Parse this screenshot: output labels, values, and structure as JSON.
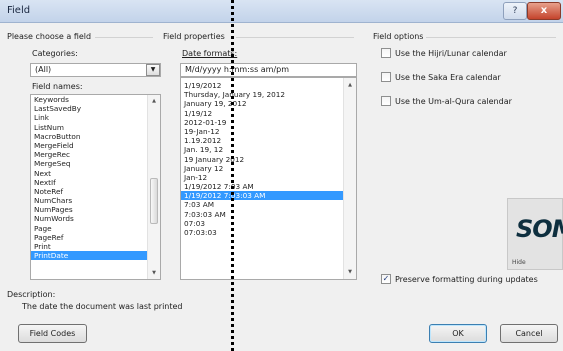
{
  "title": "Field",
  "titlebar": {
    "help_glyph": "?",
    "close_glyph": "x"
  },
  "left": {
    "header": "Please choose a field",
    "categories_label": "Categories:",
    "categories_value": "(All)",
    "field_names_label": "Field names:",
    "field_names": [
      "Keywords",
      "LastSavedBy",
      "Link",
      "ListNum",
      "MacroButton",
      "MergeField",
      "MergeRec",
      "MergeSeq",
      "Next",
      "NextIf",
      "NoteRef",
      "NumChars",
      "NumPages",
      "NumWords",
      "Page",
      "PageRef",
      "Print",
      "PrintDate"
    ],
    "selected_field": "PrintDate"
  },
  "middle": {
    "header": "Field properties",
    "date_formats_label": "Date formats:",
    "date_format_value": "M/d/yyyy h:mm:ss am/pm",
    "formats": [
      "1/19/2012",
      "Thursday, January 19, 2012",
      "January 19, 2012",
      "1/19/12",
      "2012-01-19",
      "19-Jan-12",
      "1.19.2012",
      "Jan. 19, 12",
      "19 January 2012",
      "January 12",
      "Jan-12",
      "1/19/2012 7:03 AM",
      "1/19/2012 7:03:03 AM",
      "7:03 AM",
      "7:03:03 AM",
      "07:03",
      "07:03:03"
    ],
    "selected_format": "1/19/2012 7:03:03 AM"
  },
  "right": {
    "header": "Field options",
    "options": [
      {
        "label": "Use the Hijri/Lunar calendar",
        "checked": false
      },
      {
        "label": "Use the Saka Era calendar",
        "checked": false
      },
      {
        "label": "Use the Um-al-Qura calendar",
        "checked": false
      }
    ],
    "preserve_label": "Preserve formatting during updates",
    "preserve_checked": true
  },
  "description": {
    "label": "Description:",
    "text": "The date the document was last printed"
  },
  "buttons": {
    "field_codes": "Field Codes",
    "ok": "OK",
    "cancel": "Cancel"
  },
  "logo": {
    "text": "SOM",
    "hide_label": "Hide"
  },
  "icons": [
    "dropdown-arrow-icon",
    "scroll-up-arrow-icon",
    "scroll-down-arrow-icon",
    "checkmark-icon",
    "help-icon",
    "close-icon"
  ]
}
